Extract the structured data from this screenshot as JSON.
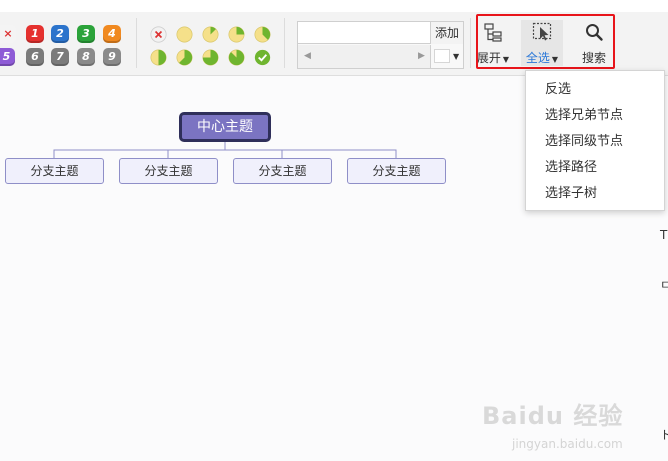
{
  "priority_icons": {
    "row1": [
      {
        "label": "×",
        "color": "#f4f4f4"
      },
      {
        "label": "1",
        "color": "#e5312f"
      },
      {
        "label": "2",
        "color": "#2c74cc"
      },
      {
        "label": "3",
        "color": "#2ba33a"
      },
      {
        "label": "4",
        "color": "#f08920"
      }
    ],
    "row2": [
      {
        "label": "5",
        "color": "#8e5bd6"
      },
      {
        "label": "6",
        "color": "#7b7b7b"
      },
      {
        "label": "7",
        "color": "#7b7b7b"
      },
      {
        "label": "8",
        "color": "#8a8a8a"
      },
      {
        "label": "9",
        "color": "#8a8a8a"
      }
    ]
  },
  "progress_icons": {
    "row1": [
      {
        "name": "progress-remove-icon",
        "fill": null
      },
      {
        "name": "progress-0-icon",
        "fill": 0
      },
      {
        "name": "progress-1-icon",
        "fill": 0.125
      },
      {
        "name": "progress-2-icon",
        "fill": 0.25
      },
      {
        "name": "progress-3-icon",
        "fill": 0.375
      }
    ],
    "row2": [
      {
        "name": "progress-4-icon",
        "fill": 0.5
      },
      {
        "name": "progress-5-icon",
        "fill": 0.625
      },
      {
        "name": "progress-6-icon",
        "fill": 0.75
      },
      {
        "name": "progress-7-icon",
        "fill": 0.875
      },
      {
        "name": "progress-done-icon",
        "fill": 1
      }
    ]
  },
  "colors": {
    "progress_empty": "#f5e08a",
    "progress_fill": "#6fb52f",
    "highlight": "#e8141a",
    "accent_blue": "#2b78d8",
    "root_fill": "#7b74c2",
    "root_border": "#2f2f5a",
    "child_fill": "#f0f0fc",
    "child_border": "#8f8fc8"
  },
  "tag_editor": {
    "input_value": "",
    "add_label": "添加",
    "scroll_left": "◀",
    "scroll_right": "▶"
  },
  "toolbar": {
    "expand_label": "展开",
    "select_all_label": "全选",
    "search_label": "搜索",
    "caret": "▼"
  },
  "select_menu": {
    "items": [
      "反选",
      "选择兄弟节点",
      "选择同级节点",
      "选择路径",
      "选择子树"
    ]
  },
  "mindmap": {
    "root": "中心主题",
    "children": [
      "分支主题",
      "分支主题",
      "分支主题",
      "分支主题"
    ]
  },
  "edge_text": {
    "top": "T",
    "middle": "ㄷ",
    "bottom": "ト"
  },
  "watermark": {
    "brand": "Baidu 经验",
    "url": "jingyan.baidu.com"
  }
}
